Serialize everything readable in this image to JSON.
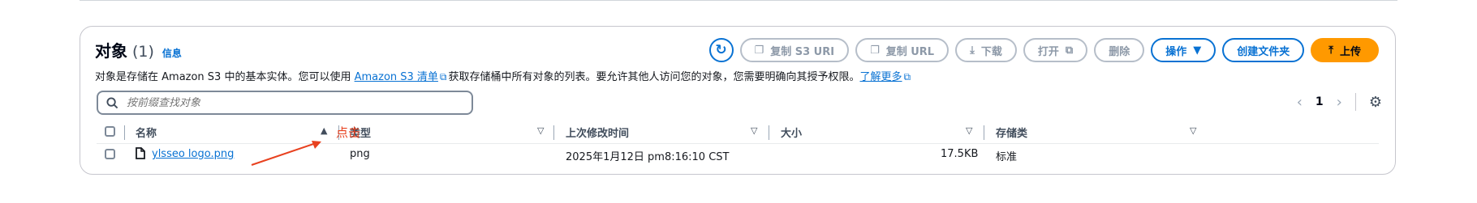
{
  "header": {
    "title": "对象",
    "count": "(1)",
    "info": "信息"
  },
  "description": {
    "part1": "对象是存储在 Amazon S3 中的基本实体。您可以使用 ",
    "link1": "Amazon S3 清单",
    "part2": "获取存储桶中所有对象的列表。要允许其他人访问您的对象，您需要明确向其授予权限。",
    "link2": "了解更多"
  },
  "toolbar": {
    "copy_s3_uri": "复制 S3 URI",
    "copy_url": "复制 URL",
    "download": "下载",
    "open": "打开",
    "delete": "删除",
    "actions": "操作",
    "create_folder": "创建文件夹",
    "upload": "上传"
  },
  "search": {
    "placeholder": "按前缀查找对象"
  },
  "pagination": {
    "page": "1"
  },
  "table": {
    "columns": [
      "名称",
      "类型",
      "上次修改时间",
      "大小",
      "存储类"
    ],
    "rows": [
      {
        "name": "ylsseo logo.png",
        "type": "png",
        "last_modified": "2025年1月12日 pm8:16:10 CST",
        "size": "17.5KB",
        "storage_class": "标准"
      }
    ]
  },
  "annotation": {
    "label": "点击",
    "color": "#e8411f"
  },
  "colors": {
    "accent": "#0972d3",
    "primary_button": "#ff9900"
  }
}
